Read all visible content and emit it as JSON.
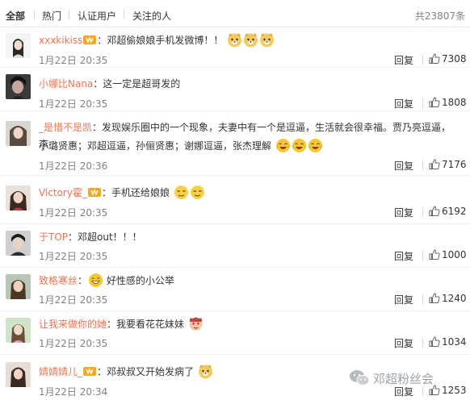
{
  "tabs": [
    {
      "label": "全部"
    },
    {
      "label": "热门"
    },
    {
      "label": "认证用户"
    },
    {
      "label": "关注的人"
    }
  ],
  "total_label": "共23807条",
  "reply_label": "回复",
  "watermark": "邓超粉丝会",
  "accent_color": "#eb7350",
  "comments": [
    {
      "user": "xxxkikiss",
      "text": "：邓超偷娘娘手机发微博！！",
      "text2": "",
      "time": "1月22日 20:35",
      "likes": "7308"
    },
    {
      "user": "小娜比Nana",
      "text": "：这一定是超哥发的",
      "text2": "",
      "time": "1月22日 20:35",
      "likes": "1808"
    },
    {
      "user": "_是惜不是凯",
      "text": "：发现娱乐圈中的一个现象，夫妻中有一个是逗逼，生活就会很幸福。贾乃亮逗逼，李",
      "text2": "小璐贤惠；邓超逗逼，孙俪贤惠；谢娜逗逼，张杰理解",
      "time": "1月22日 20:36",
      "likes": "7176"
    },
    {
      "user": "Victory霍_",
      "text": "：手机还给娘娘",
      "text2": "",
      "time": "1月22日 20:35",
      "likes": "6192"
    },
    {
      "user": "于TOP",
      "text": "：邓超out！！！",
      "text2": "",
      "time": "1月22日 20:35",
      "likes": "1000"
    },
    {
      "user": "致格寒丝",
      "text": "：",
      "text_after": " 好性感的小公举",
      "text2": "",
      "time": "1月22日 20:35",
      "likes": "1240"
    },
    {
      "user": "让我来做你的她",
      "text": "：我要看花花妹妹",
      "text2": "",
      "time": "1月22日 20:35",
      "likes": "1034"
    },
    {
      "user": "婧婧婧儿_",
      "text": "：邓叔叔又开始发病了",
      "text2": "",
      "time": "1月22日 20:34",
      "likes": "1253"
    }
  ]
}
